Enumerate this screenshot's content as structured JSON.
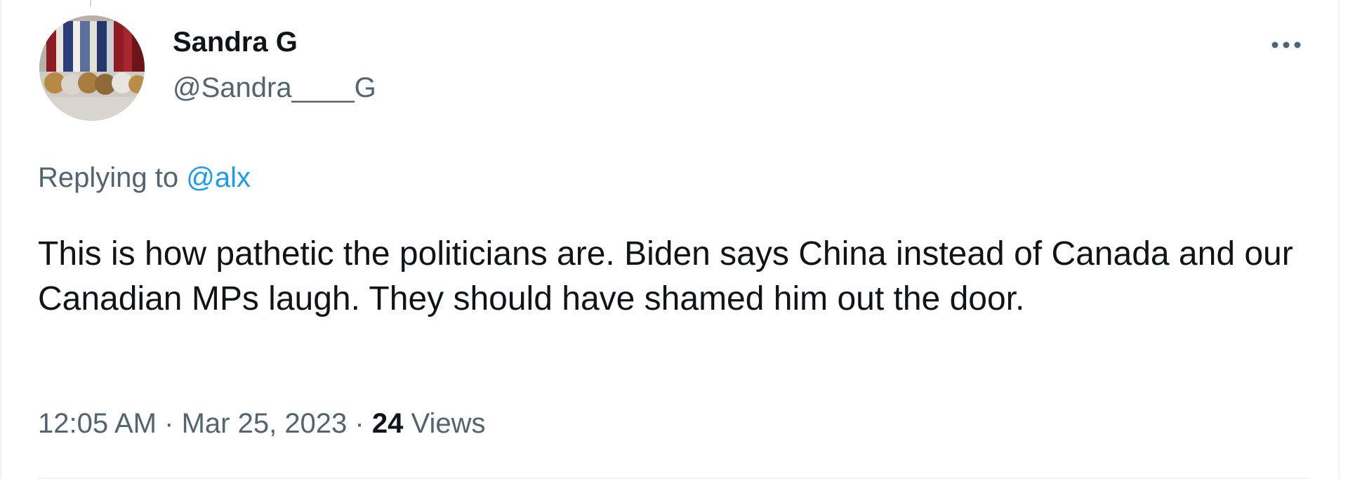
{
  "tweet": {
    "author": {
      "display_name": "Sandra G",
      "handle": "@Sandra____G"
    },
    "reply": {
      "prefix": "Replying to",
      "mention": "@alx"
    },
    "text": "This is how pathetic the politicians are. Biden says China instead of Canada and our Canadian MPs laugh. They should have shamed him out the door.",
    "time": "12:05 AM",
    "date": "Mar 25, 2023",
    "separator": "·",
    "views_count": "24",
    "views_label": "Views",
    "more_icon": "more-horizontal-icon"
  },
  "colors": {
    "text_primary": "#0f1419",
    "text_secondary": "#536471",
    "link": "#1d9bf0",
    "border": "#eff3f4"
  }
}
